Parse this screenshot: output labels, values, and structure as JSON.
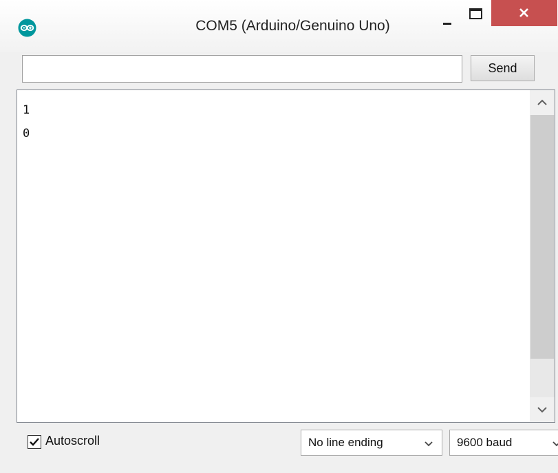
{
  "window": {
    "title": "COM5 (Arduino/Genuino Uno)",
    "icon": "arduino-logo-icon",
    "controls": {
      "minimize": "minimize-icon",
      "maximize": "maximize-icon",
      "close": "close-icon"
    },
    "accent_color": "#00979d",
    "close_color": "#c75050"
  },
  "input": {
    "value": "",
    "placeholder": ""
  },
  "send_button": {
    "label": "Send"
  },
  "output": {
    "lines": [
      "1",
      "0"
    ]
  },
  "footer": {
    "autoscroll": {
      "label": "Autoscroll",
      "checked": true
    },
    "line_ending": {
      "selected": "No line ending"
    },
    "baud_rate": {
      "selected": "9600 baud"
    }
  }
}
